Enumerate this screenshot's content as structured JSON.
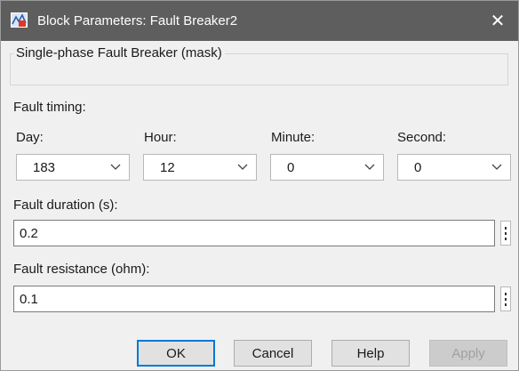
{
  "window": {
    "title": "Block Parameters: Fault Breaker2",
    "app_icon": "simulink-block-icon",
    "close_label": "✕"
  },
  "mask": {
    "title": "Single-phase Fault Breaker (mask)"
  },
  "fault_timing": {
    "heading": "Fault timing:",
    "fields": [
      {
        "label": "Day:",
        "value": "183"
      },
      {
        "label": "Hour:",
        "value": "12"
      },
      {
        "label": "Minute:",
        "value": "0"
      },
      {
        "label": "Second:",
        "value": "0"
      }
    ]
  },
  "fault_duration": {
    "label": "Fault duration (s):",
    "value": "0.2"
  },
  "fault_resistance": {
    "label": "Fault resistance (ohm):",
    "value": "0.1"
  },
  "buttons": {
    "ok": "OK",
    "cancel": "Cancel",
    "help": "Help",
    "apply": "Apply"
  }
}
